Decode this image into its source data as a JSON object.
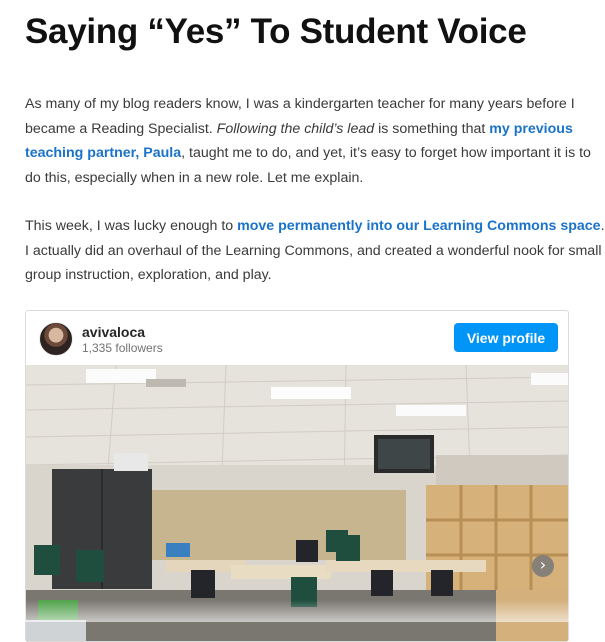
{
  "post": {
    "title": "Saying “Yes” To Student Voice",
    "p1": {
      "t1": "As many of my blog readers know, I was a kindergarten teacher for many years before I became a Reading Specialist. ",
      "italic": "Following the child’s lead",
      "t2": " is something that ",
      "link": "my previous teaching partner, Paula",
      "t3": ", taught me to do, and yet, it’s easy to forget how important it is to do this, especially when in a new role. Let me explain."
    },
    "p2": {
      "t1": "This week, I was lucky enough to ",
      "link": "move permanently into our Learning Commons space",
      "t2": ". I actually did an overhaul of the Learning Commons, and created a wonderful nook for small group instruction, exploration, and play."
    }
  },
  "embed": {
    "username": "avivaloca",
    "followers": "1,335 followers",
    "button_label": "View profile",
    "next_icon": "chevron-right-icon"
  },
  "colors": {
    "link": "#1a73c8",
    "button": "#0095f6",
    "title": "#111111",
    "body_text": "#3a3a3a"
  }
}
